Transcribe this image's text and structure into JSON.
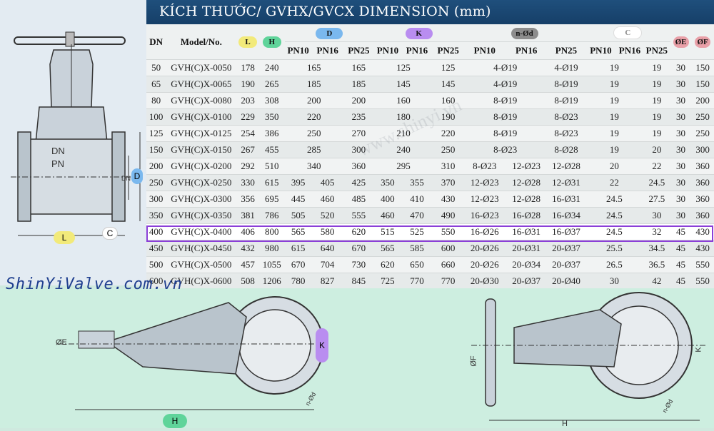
{
  "header": {
    "title": "KÍCH THƯỚC/ GVHX/GVCX DIMENSION (mm)"
  },
  "brand": {
    "text": "ShinYiValve.com.vn"
  },
  "watermark": {
    "text": "www.shinyi.vn"
  },
  "colors": {
    "L": "#f2ea7a",
    "H": "#5fd49a",
    "D": "#7ab8ee",
    "K": "#b98df0",
    "nd": "#8d8d8d",
    "C": "#ffffff",
    "E": "#e9a0a8",
    "F": "#e9a0a8",
    "highlight": "#8b3fd8",
    "header_bg": "#1f4f7c"
  },
  "table": {
    "col_dn": "DN",
    "col_model": "Model/No.",
    "group_L": "L",
    "group_H": "H",
    "group_D": "D",
    "group_K": "K",
    "group_nd": "n-Ød",
    "group_C": "C",
    "group_E": "ØE",
    "group_F": "ØF",
    "sub": [
      "PN10",
      "PN16",
      "PN25",
      "PN10",
      "PN16",
      "PN25",
      "PN10",
      "PN16",
      "PN25",
      "PN10",
      "PN16",
      "PN25"
    ],
    "rows": [
      {
        "dn": "50",
        "model": "GVH(C)X-0050",
        "L": "178",
        "H": "240",
        "D": [
          "165",
          "",
          "165"
        ],
        "K": [
          "125",
          "",
          "125"
        ],
        "nd": [
          "4-Ø19",
          "",
          "4-Ø19"
        ],
        "C": [
          "19",
          "",
          "19"
        ],
        "E": "30",
        "F": "150"
      },
      {
        "dn": "65",
        "model": "GVH(C)X-0065",
        "L": "190",
        "H": "265",
        "D": [
          "185",
          "",
          "185"
        ],
        "K": [
          "145",
          "",
          "145"
        ],
        "nd": [
          "4-Ø19",
          "",
          "8-Ø19"
        ],
        "C": [
          "19",
          "",
          "19"
        ],
        "E": "30",
        "F": "150"
      },
      {
        "dn": "80",
        "model": "GVH(C)X-0080",
        "L": "203",
        "H": "308",
        "D": [
          "200",
          "",
          "200"
        ],
        "K": [
          "160",
          "",
          "160"
        ],
        "nd": [
          "8-Ø19",
          "",
          "8-Ø19"
        ],
        "C": [
          "19",
          "",
          "19"
        ],
        "E": "30",
        "F": "200"
      },
      {
        "dn": "100",
        "model": "GVH(C)X-0100",
        "L": "229",
        "H": "350",
        "D": [
          "220",
          "",
          "235"
        ],
        "K": [
          "180",
          "",
          "190"
        ],
        "nd": [
          "8-Ø19",
          "",
          "8-Ø23"
        ],
        "C": [
          "19",
          "",
          "19"
        ],
        "E": "30",
        "F": "250"
      },
      {
        "dn": "125",
        "model": "GVH(C)X-0125",
        "L": "254",
        "H": "386",
        "D": [
          "250",
          "",
          "270"
        ],
        "K": [
          "210",
          "",
          "220"
        ],
        "nd": [
          "8-Ø19",
          "",
          "8-Ø23"
        ],
        "C": [
          "19",
          "",
          "19"
        ],
        "E": "30",
        "F": "250"
      },
      {
        "dn": "150",
        "model": "GVH(C)X-0150",
        "L": "267",
        "H": "455",
        "D": [
          "285",
          "",
          "300"
        ],
        "K": [
          "240",
          "",
          "250"
        ],
        "nd": [
          "8-Ø23",
          "",
          "8-Ø28"
        ],
        "C": [
          "19",
          "",
          "20"
        ],
        "E": "30",
        "F": "300"
      },
      {
        "dn": "200",
        "model": "GVH(C)X-0200",
        "L": "292",
        "H": "510",
        "D": [
          "340",
          "",
          "360"
        ],
        "K": [
          "295",
          "",
          "310"
        ],
        "nd": [
          "8-Ø23",
          "12-Ø23",
          "12-Ø28"
        ],
        "C": [
          "20",
          "",
          "22"
        ],
        "E": "30",
        "F": "360"
      },
      {
        "dn": "250",
        "model": "GVH(C)X-0250",
        "L": "330",
        "H": "615",
        "D": [
          "395",
          "405",
          "425"
        ],
        "K": [
          "350",
          "355",
          "370"
        ],
        "nd": [
          "12-Ø23",
          "12-Ø28",
          "12-Ø31"
        ],
        "C": [
          "22",
          "",
          "24.5"
        ],
        "E": "30",
        "F": "360"
      },
      {
        "dn": "300",
        "model": "GVH(C)X-0300",
        "L": "356",
        "H": "695",
        "D": [
          "445",
          "460",
          "485"
        ],
        "K": [
          "400",
          "410",
          "430"
        ],
        "nd": [
          "12-Ø23",
          "12-Ø28",
          "16-Ø31"
        ],
        "C": [
          "24.5",
          "",
          "27.5"
        ],
        "E": "30",
        "F": "360"
      },
      {
        "dn": "350",
        "model": "GVH(C)X-0350",
        "L": "381",
        "H": "786",
        "D": [
          "505",
          "520",
          "555"
        ],
        "K": [
          "460",
          "470",
          "490"
        ],
        "nd": [
          "16-Ø23",
          "16-Ø28",
          "16-Ø34"
        ],
        "C": [
          "24.5",
          "",
          "30"
        ],
        "E": "30",
        "F": "360"
      },
      {
        "dn": "400",
        "model": "GVH(C)X-0400",
        "L": "406",
        "H": "800",
        "D": [
          "565",
          "580",
          "620"
        ],
        "K": [
          "515",
          "525",
          "550"
        ],
        "nd": [
          "16-Ø26",
          "16-Ø31",
          "16-Ø37"
        ],
        "C": [
          "24.5",
          "",
          "32"
        ],
        "E": "45",
        "F": "430"
      },
      {
        "dn": "450",
        "model": "GVH(C)X-0450",
        "L": "432",
        "H": "980",
        "D": [
          "615",
          "640",
          "670"
        ],
        "K": [
          "565",
          "585",
          "600"
        ],
        "nd": [
          "20-Ø26",
          "20-Ø31",
          "20-Ø37"
        ],
        "C": [
          "25.5",
          "",
          "34.5"
        ],
        "E": "45",
        "F": "430"
      },
      {
        "dn": "500",
        "model": "GVH(C)X-0500",
        "L": "457",
        "H": "1055",
        "D": [
          "670",
          "704",
          "730"
        ],
        "K": [
          "620",
          "650",
          "660"
        ],
        "nd": [
          "20-Ø26",
          "20-Ø34",
          "20-Ø37"
        ],
        "C": [
          "26.5",
          "",
          "36.5"
        ],
        "E": "45",
        "F": "550"
      },
      {
        "dn": "600",
        "model": "GVH(C)X-0600",
        "L": "508",
        "H": "1206",
        "D": [
          "780",
          "827",
          "845"
        ],
        "K": [
          "725",
          "770",
          "770"
        ],
        "nd": [
          "20-Ø30",
          "20-Ø37",
          "20-Ø40"
        ],
        "C": [
          "30",
          "",
          "42"
        ],
        "E": "45",
        "F": "550"
      }
    ]
  },
  "drawings": {
    "front": {
      "dn": "DN",
      "pn": "PN",
      "dim_L": "L",
      "dim_D": "D",
      "dim_C": "C",
      "dim_DN": "DN"
    },
    "bottom_left": {
      "dim_E": "ØE",
      "dim_H": "H",
      "dim_K": "K",
      "dim_nd": "n-Ød"
    },
    "bottom_right": {
      "dim_F": "ØF",
      "dim_H": "H",
      "dim_K": "K",
      "dim_nd": "n-Ød"
    }
  }
}
